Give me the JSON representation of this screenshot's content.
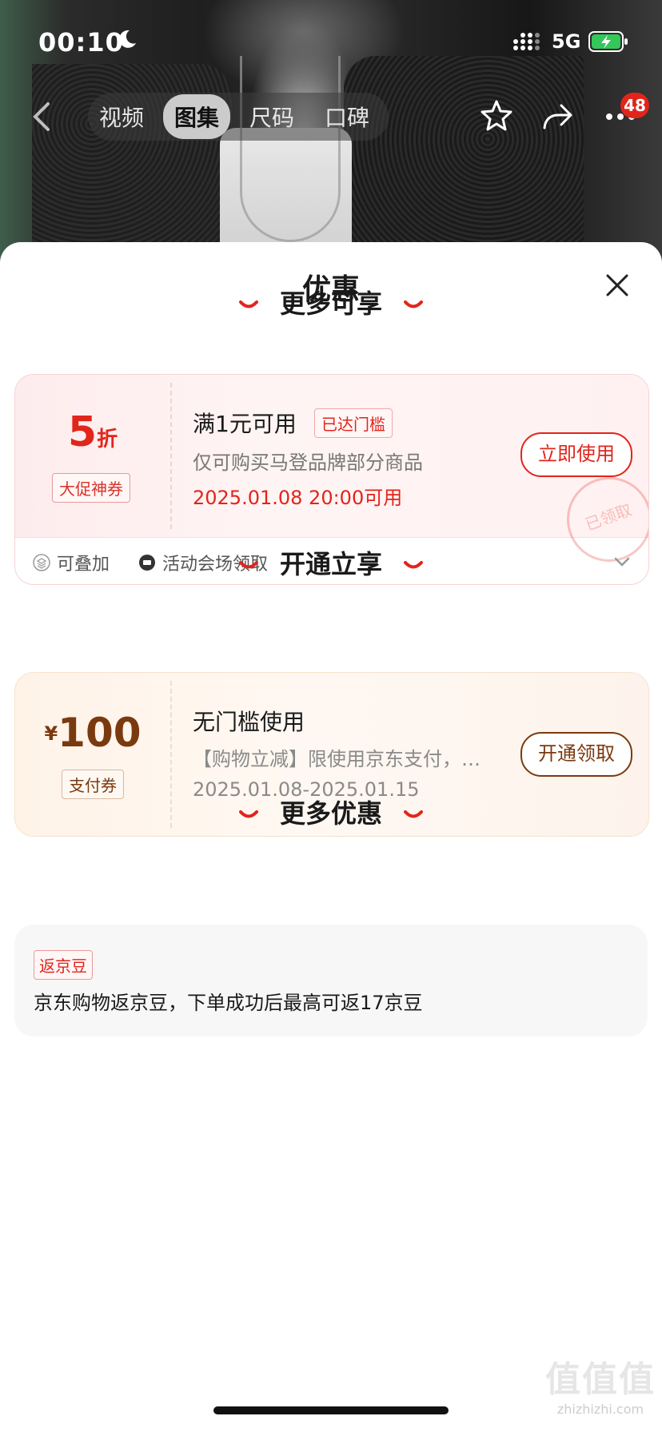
{
  "status_bar": {
    "time": "00:10",
    "network": "5G"
  },
  "nav": {
    "tabs": [
      {
        "label": "视频"
      },
      {
        "label": "图集"
      },
      {
        "label": "尺码"
      },
      {
        "label": "口碑"
      }
    ],
    "active_tab": "图集",
    "more_badge": "48"
  },
  "sheet": {
    "title": "优惠",
    "sections": {
      "more_enjoy": "更多可享",
      "open_enjoy": "开通立享",
      "more_offers": "更多优惠"
    },
    "coupon_discount": {
      "value": "5",
      "unit": "折",
      "tag": "大促神券",
      "title": "满1元可用",
      "status_pill": "已达门槛",
      "desc": "仅可购买马登品牌部分商品",
      "date": "2025.01.08 20:00可用",
      "button": "立即使用",
      "stamp": "已领取",
      "footer_stackable": "可叠加",
      "footer_source": "活动会场领取"
    },
    "coupon_pay": {
      "currency": "¥",
      "value": "100",
      "tag": "支付券",
      "title": "无门槛使用",
      "desc": "【购物立减】限使用京东支付，…",
      "date": "2025.01.08-2025.01.15",
      "button": "开通领取"
    },
    "bean_offer": {
      "tag": "返京豆",
      "text": "京东购物返京豆，下单成功后最高可返17京豆"
    }
  },
  "watermark": {
    "text": "值值值",
    "sub": "zhizhizhi.com"
  },
  "colors": {
    "accent": "#e1251b",
    "pay_brown": "#7a3a10"
  }
}
